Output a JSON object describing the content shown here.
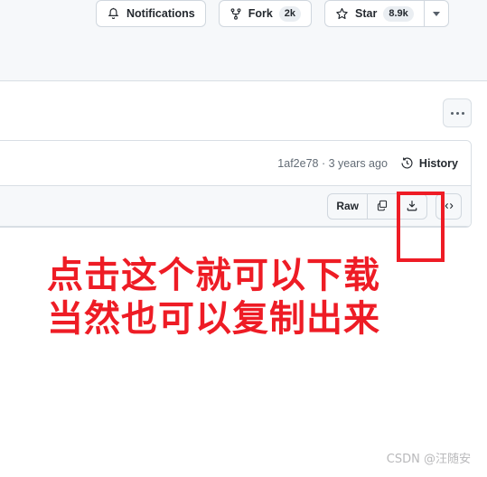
{
  "repo_actions": {
    "notifications": {
      "label": "Notifications",
      "icon": "bell-icon"
    },
    "fork": {
      "label": "Fork",
      "count": "2k",
      "icon": "fork-icon"
    },
    "star": {
      "label": "Star",
      "count": "8.9k",
      "icon": "star-icon"
    },
    "star_dropdown": {
      "icon": "chevron-down-icon"
    }
  },
  "more_menu": {
    "icon": "kebab-horizontal-icon"
  },
  "file_box": {
    "commit": {
      "hash": "1af2e78",
      "separator": "·",
      "relative_time": "3 years ago",
      "meta": "1af2e78 · 3 years ago"
    },
    "history": {
      "label": "History",
      "icon": "history-clock-icon"
    },
    "toolbar": {
      "raw_label": "Raw",
      "copy_icon": "copy-icon",
      "download_icon": "download-icon",
      "code_icon": "code-brackets-icon"
    }
  },
  "annotation": {
    "line1": "点击这个就可以下载",
    "line2": "当然也可以复制出来",
    "highlight_color": "#ee1c25",
    "rect_target": "download-button"
  },
  "watermark": {
    "text": "CSDN @汪随安"
  }
}
